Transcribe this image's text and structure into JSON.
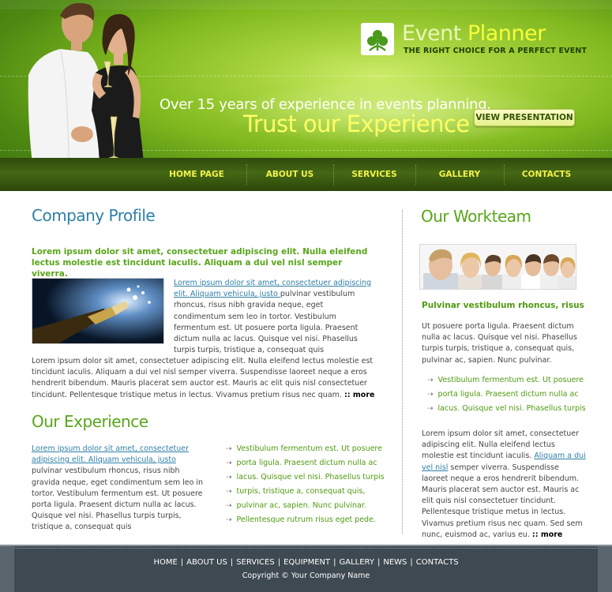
{
  "header": {
    "logo_word1": "Event",
    "logo_word2": "Planner",
    "tagline": "THE RIGHT CHOICE FOR A PERFECT EVENT",
    "hero_line1": "Over 15 years of experience in events planning.",
    "hero_line2": "Trust our Experience",
    "view_button": "VIEW PRESENTATION"
  },
  "nav": {
    "items": [
      {
        "label": "HOME PAGE"
      },
      {
        "label": "ABOUT US"
      },
      {
        "label": "SERVICES"
      },
      {
        "label": "GALLERY"
      },
      {
        "label": "CONTACTS"
      }
    ]
  },
  "profile": {
    "title": "Company Profile",
    "intro": "Lorem ipsum dolor sit amet, consectetuer adipiscing elit. Nulla eleifend lectus molestie est tincidunt iaculis. Aliquam a dui vel nisl semper viverra.",
    "link": "Lorem ipsum dolor sit amet, consectetuer adipiscing elit. Aliquam vehicula, justo ",
    "text_after_link": "pulvinar vestibulum rhoncus, risus nibh gravida neque, eget condimentum sem leo in tortor. Vestibulum fermentum est. Ut posuere porta ligula. Praesent dictum nulla ac lacus. Quisque vel nisi. Phasellus turpis turpis, tristique a, consequat quis",
    "para": "Lorem ipsum dolor sit amet, consectetuer adipiscing elit. Nulla eleifend lectus molestie est tincidunt iaculis. Aliquam a dui vel nisl semper viverra. Suspendisse laoreet neque a eros hendrerit bibendum. Mauris placerat sem auctor est. Mauris ac elit quis nisl consectetuer tincidunt. Pellentesque tristique metus in lectus. Vivamus pretium risus nec quam.",
    "more_label": "more"
  },
  "experience": {
    "title": "Our Experience",
    "link": "Lorem ipsum dolor sit amet, consectetuer adipiscing elit. Aliquam vehicula, justo ",
    "text_after_link": "pulvinar vestibulum rhoncus, risus nibh gravida neque, eget condimentum sem leo in tortor. Vestibulum fermentum est. Ut posuere porta ligula. Praesent dictum nulla ac lacus. Quisque vel nisi. Phasellus turpis turpis, tristique a, consequat quis",
    "list": [
      "Vestibulum fermentum est. Ut posuere",
      "porta ligula. Praesent dictum nulla ac",
      "lacus. Quisque vel nisi. Phasellus turpis",
      "turpis, tristique a, consequat quis,",
      "pulvinar ac, sapien. Nunc pulvinar.",
      "Pellentesque rutrum risus eget pede."
    ]
  },
  "workteam": {
    "title": "Our Workteam",
    "subtitle": "Pulvinar vestibulum rhoncus, risus",
    "para1": "Ut posuere porta ligula. Praesent dictum nulla ac lacus. Quisque vel nisi. Phasellus turpis turpis, tristique a, consequat quis, pulvinar ac, sapien. Nunc pulvinar.",
    "list": [
      "Vestibulum fermentum est. Ut posuere",
      "porta ligula. Praesent dictum nulla ac",
      "lacus. Quisque vel nisi. Phasellus turpis"
    ],
    "para2_before": "Lorem ipsum dolor sit amet, consectetuer adipiscing elit. Nulla eleifend lectus molestie est tincidunt iaculis. ",
    "para2_link": "Aliquam a dui vel nisl",
    "para2_after": " semper viverra. Suspendisse laoreet neque a eros hendrerit bibendum. Mauris placerat sem auctor est. Mauris ac elit quis nisl consectetuer tincidunt. Pellentesque tristique metus in lectus. Vivamus pretium risus nec quam. Sed sem nunc, euismod ac, varius eu.",
    "more_label": "more"
  },
  "footer": {
    "links": [
      "HOME",
      "ABOUT US",
      "SERVICES",
      "EQUIPMENT",
      "GALLERY",
      "NEWS",
      "CONTACTS"
    ],
    "copyright": "Copyright © Your Company Name"
  },
  "icons": {
    "logo": "leaf-logo-icon",
    "list_bullet": "arrow-right-icon"
  },
  "colors": {
    "brand_green": "#58a61a",
    "heading_blue": "#2e7fa8",
    "nav_text": "#f2f24a",
    "footer_bg": "#3e4951"
  }
}
